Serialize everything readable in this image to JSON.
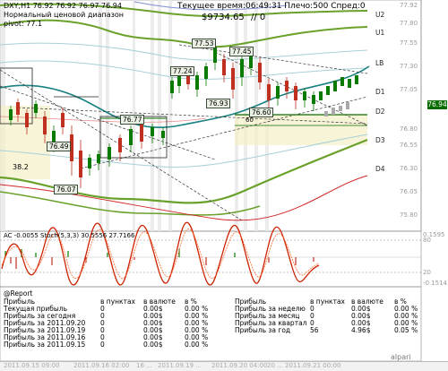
{
  "header": {
    "symbol_line": "DXY,H1  76.92 76.92 76.97 76.94",
    "indicator_name": "Нормальный ценовой диапазон",
    "pivot_label": "pivot: 77.1",
    "time_label": "Текущее время:06:49:31 Плечо:500 Спред:0",
    "balance": "$9734.65",
    "slash_value": "// 0"
  },
  "level_labels": {
    "u2": "U2",
    "u1": "U1",
    "lb": "LB",
    "d1": "D1",
    "d2": "D2",
    "d3": "D3",
    "d4": "D4"
  },
  "price_axis": [
    "77.92",
    "77.80",
    "77.55",
    "77.30",
    "77.05",
    "76.94",
    "76.80",
    "76.55",
    "76.30",
    "76.05",
    "75.80"
  ],
  "current_price": "76.94",
  "chart_tags": [
    "77.53",
    "77.45",
    "77.24",
    "76.93",
    "76.77",
    "76.49",
    "76.07",
    "76.60",
    "38.2",
    "60"
  ],
  "oscillator": {
    "label": "AC -0.0055  Stoch(5,3,3) 30.5556 27.7166",
    "axis": [
      "0.1595",
      "80",
      "20",
      "-0.1514"
    ]
  },
  "report": {
    "title": "@Report",
    "headers": [
      "Прибыль",
      "в пунктах",
      "в валюте",
      "в %",
      "Прибыль",
      "в пунктах",
      "в валюте",
      "в %"
    ],
    "left_rows": [
      [
        "Текущая прибыль",
        "0",
        "0.00$",
        "0.00 %"
      ],
      [
        "Прибыль за сегодня",
        "0",
        "0.00$",
        "0.00 %"
      ],
      [
        "Прибыль за 2011.09.20",
        "0",
        "0.00$",
        "0.00 %"
      ],
      [
        "Прибыль за 2011.09.19",
        "0",
        "0.00$",
        "0.00 %"
      ],
      [
        "Прибыль за 2011.09.16",
        "0",
        "0.00$",
        "0.00 %"
      ],
      [
        "Прибыль за 2011.09.15",
        "0",
        "0.00$",
        "0.00 %"
      ]
    ],
    "right_rows": [
      [
        "Прибыль за неделю",
        "0",
        "0.00$",
        "0.00 %"
      ],
      [
        "Прибыль за месяц",
        "0",
        "0.00$",
        "0.00 %"
      ],
      [
        "Прибыль за квартал",
        "0",
        "0.00$",
        "0.00 %"
      ],
      [
        "Прибыль за год",
        "56",
        "4.96$",
        "0.05 %"
      ]
    ]
  },
  "time_axis": [
    "2011.09.15 09:00",
    "2011.09.16 02:00",
    "16 ...",
    "2011.09.19 ...",
    "2011.09.20 04:00",
    "20 ...",
    "2011.09.21 00:00"
  ],
  "brand": "alpari",
  "colors": {
    "background": "#ffffff",
    "envelope": "#6aa12a",
    "ma": "#1a8080",
    "price_tag": "#0a6b00",
    "stoch": "#cc2200"
  }
}
